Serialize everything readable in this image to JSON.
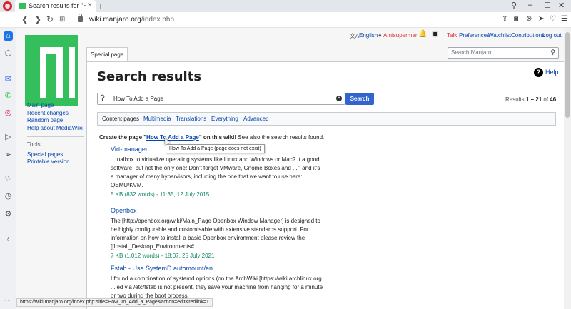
{
  "browser": {
    "tab_title": "Search results for \"How",
    "url_domain": "wiki.manjaro.org",
    "url_path": "/index.php",
    "status_url": "https://wiki.manjaro.org/index.php?title=How_To_Add_a_Page&action=edit&redlink=1",
    "accent_color": "#1a73e8"
  },
  "personal": {
    "language": "English",
    "username": "Amisuperman",
    "talk": "Talk",
    "preferences": "Preferences",
    "watchlist": "Watchlist",
    "contributions": "Contributions",
    "logout": "Log out"
  },
  "sidebar": {
    "main_links": [
      "Main page",
      "Recent changes",
      "Random page",
      "Help about MediaWiki"
    ],
    "tools_heading": "Tools",
    "tools_links": [
      "Special pages",
      "Printable version"
    ]
  },
  "page": {
    "tab_label": "Special page",
    "top_search_placeholder": "Search Manjaro",
    "title": "Search results",
    "help": "Help",
    "search_value": "How To Add a Page",
    "search_button": "Search",
    "results_prefix": "Results ",
    "results_range": "1 – 21",
    "results_of": " of ",
    "results_total": "46",
    "filters": [
      "Content pages",
      "Multimedia",
      "Translations",
      "Everything",
      "Advanced"
    ],
    "create_prefix": "Create the page \"",
    "create_link": "How To Add a Page",
    "create_suffix": "\" on this wiki!",
    "create_after": " See also the search results found.",
    "tooltip": "How To Add a Page (page does not exist)"
  },
  "results": [
    {
      "title": "Virt-manager",
      "snippet": "...tualbox to virtualize operating systems like Linux and Windows or Mac? It a good software, but not the only one! Don't forget VMware, Gnome Boxes and ...'\" and it's a manager of many hypervisors, including the one that we want to use here: QEMU/KVM.",
      "meta": "5 KB (832 words) - 11:35, 12 July 2015"
    },
    {
      "title": "Openbox",
      "snippet": "The [http://openbox.org/wiki/Main_Page Openbox Window Manager] is designed to be highly configurable and customisable with extensive standards support. For information on how to install a basic Openbox environment please review the [[Install_Desktop_Environments#",
      "meta": "7 KB (1,012 words) - 18:07, 25 July 2021"
    },
    {
      "title": "Fstab - Use SystemD automount/en",
      "snippet": "I found a combination of systemd options (on the ArchWiki [https://wiki.archlinux.org ...led via /etc/fstab is not present, they save your machine from hanging for a minute or two during the boot process.",
      "meta": ""
    }
  ]
}
